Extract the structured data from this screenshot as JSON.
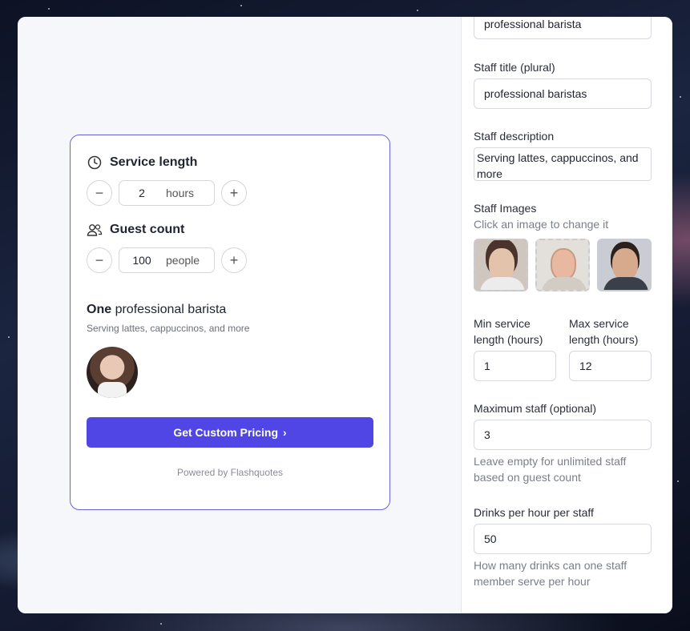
{
  "widget": {
    "service_length": {
      "label": "Service length",
      "value": "2",
      "unit": "hours"
    },
    "guest_count": {
      "label": "Guest count",
      "value": "100",
      "unit": "people"
    },
    "staff_count_word": "One",
    "staff_title": "professional barista",
    "staff_description": "Serving lattes, cappuccinos, and more",
    "cta_label": "Get Custom Pricing",
    "powered_by": "Powered by Flashquotes"
  },
  "settings": {
    "staff_title_singular_value": "professional barista",
    "staff_title_plural": {
      "label": "Staff title (plural)",
      "value": "professional baristas"
    },
    "staff_description": {
      "label": "Staff description",
      "value": "Serving lattes, cappuccinos, and more"
    },
    "staff_images": {
      "label": "Staff Images",
      "hint": "Click an image to change it"
    },
    "min_service": {
      "label_line1": "Min service",
      "label_line2": "length (hours)",
      "value": "1"
    },
    "max_service": {
      "label_line1": "Max service",
      "label_line2": "length (hours)",
      "value": "12"
    },
    "max_staff": {
      "label": "Maximum staff (optional)",
      "value": "3",
      "hint_line1": "Leave empty for unlimited staff",
      "hint_line2": "based on guest count"
    },
    "drinks_per_hour": {
      "label": "Drinks per hour per staff",
      "value": "50",
      "hint_line1": "How many drinks can one staff",
      "hint_line2": "member serve per hour"
    }
  },
  "icons": {
    "clock": "clock-icon",
    "users": "users-icon",
    "minus": "−",
    "plus": "+",
    "chevron": "›"
  },
  "colors": {
    "accent": "#4f46e5",
    "card_border": "#6b63d9"
  }
}
